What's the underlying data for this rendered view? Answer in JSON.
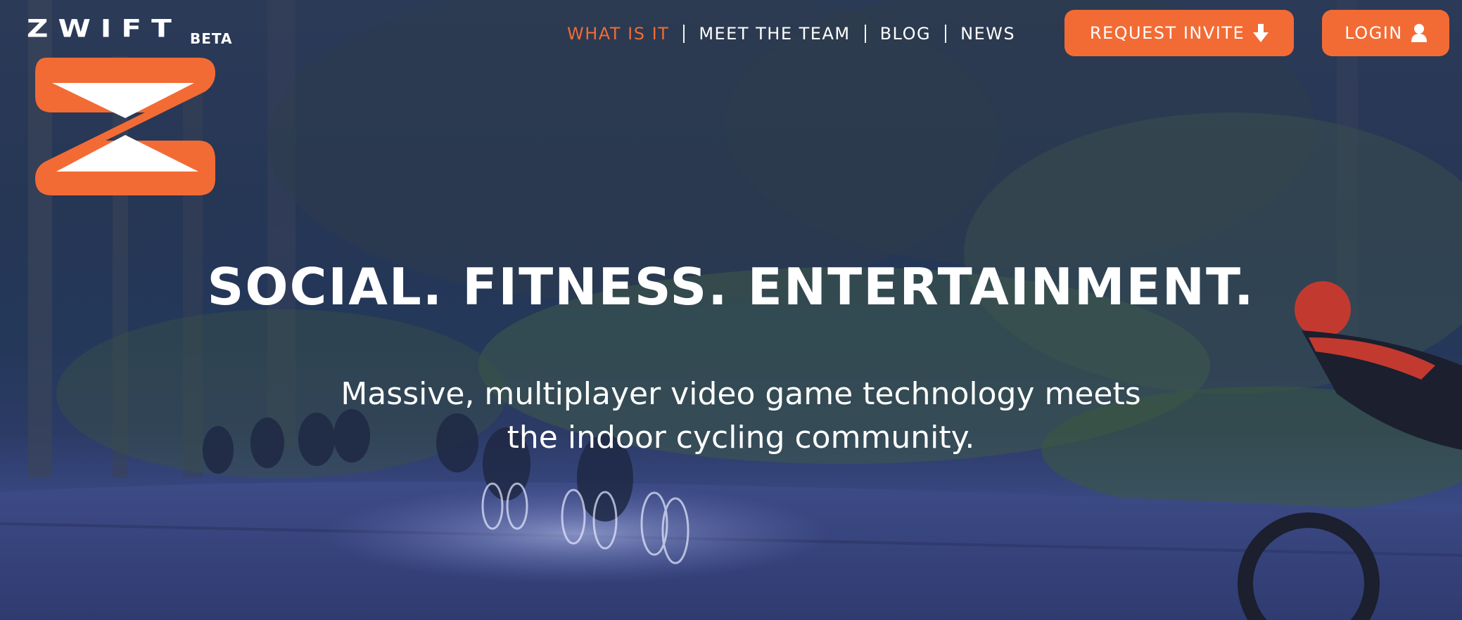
{
  "brand": {
    "wordmark": "ZWIFT",
    "tag": "BETA",
    "accent_color": "#f26b35"
  },
  "nav": {
    "items": [
      {
        "label": "WHAT IS IT",
        "active": true
      },
      {
        "label": "MEET THE TEAM",
        "active": false
      },
      {
        "label": "BLOG",
        "active": false
      },
      {
        "label": "NEWS",
        "active": false
      }
    ]
  },
  "actions": {
    "request_invite": {
      "label": "REQUEST INVITE",
      "icon": "arrow-down-icon"
    },
    "login": {
      "label": "LOGIN",
      "icon": "user-icon"
    }
  },
  "hero": {
    "headline": "SOCIAL. FITNESS. ENTERTAINMENT.",
    "subhead_line1": "Massive, multiplayer video game technology meets",
    "subhead_line2": "the indoor cycling community.",
    "background": "night-forest-cycling-scene"
  }
}
